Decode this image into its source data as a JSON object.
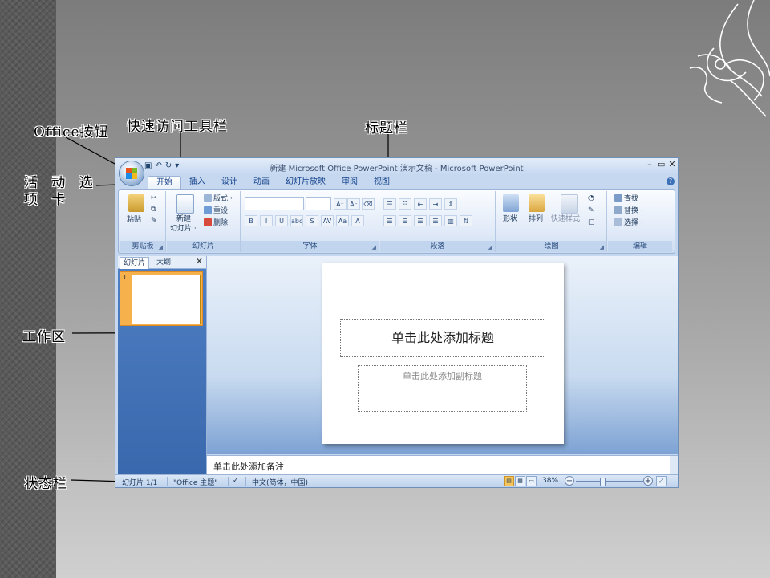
{
  "callouts": {
    "office_button": "Office按钮",
    "quick_access": "快速访问工具栏",
    "title_bar": "标题栏",
    "active_tab": "活 动 选 项 卡",
    "work_area": "工作区",
    "status_bar": "状态栏"
  },
  "window": {
    "title": "新建 Microsoft Office PowerPoint 演示文稿 - Microsoft PowerPoint",
    "qat": {
      "save": "▣",
      "undo": "↶",
      "redo": "↻",
      "more": "▾"
    },
    "controls": {
      "minimize": "–",
      "restore": "▭",
      "close": "✕"
    },
    "help": "?"
  },
  "tabs": [
    "开始",
    "插入",
    "设计",
    "动画",
    "幻灯片放映",
    "审阅",
    "视图"
  ],
  "ribbon": {
    "clipboard": {
      "label": "剪贴板",
      "paste": "粘贴"
    },
    "slides": {
      "label": "幻灯片",
      "new_slide_1": "新建",
      "new_slide_2": "幻灯片 ·",
      "layout": "版式 ·",
      "reset": "重设",
      "delete": "删除"
    },
    "font": {
      "label": "字体",
      "buttons": [
        "B",
        "I",
        "U",
        "abc",
        "S",
        "AV",
        "Aa",
        "A"
      ],
      "grow": "A⁺",
      "shrink": "A⁻",
      "clear": "⌫"
    },
    "paragraph": {
      "label": "段落"
    },
    "drawing": {
      "label": "绘图",
      "shapes": "形状",
      "arrange": "排列",
      "quick_styles": "快速样式"
    },
    "editing": {
      "label": "编辑",
      "find": "查找",
      "replace": "替换 ·",
      "select": "选择 ·"
    }
  },
  "left_pane": {
    "tab_slides": "幻灯片",
    "tab_outline": "大纲",
    "close": "✕",
    "slide_number": "1"
  },
  "slide": {
    "title_placeholder": "单击此处添加标题",
    "subtitle_placeholder": "单击此处添加副标题"
  },
  "notes": {
    "placeholder": "单击此处添加备注"
  },
  "status": {
    "slide_count": "幻灯片 1/1",
    "theme": "\"Office 主题\"",
    "language": "中文(简体，中国)",
    "zoom": "38%",
    "zoom_fraction": 0.38
  }
}
